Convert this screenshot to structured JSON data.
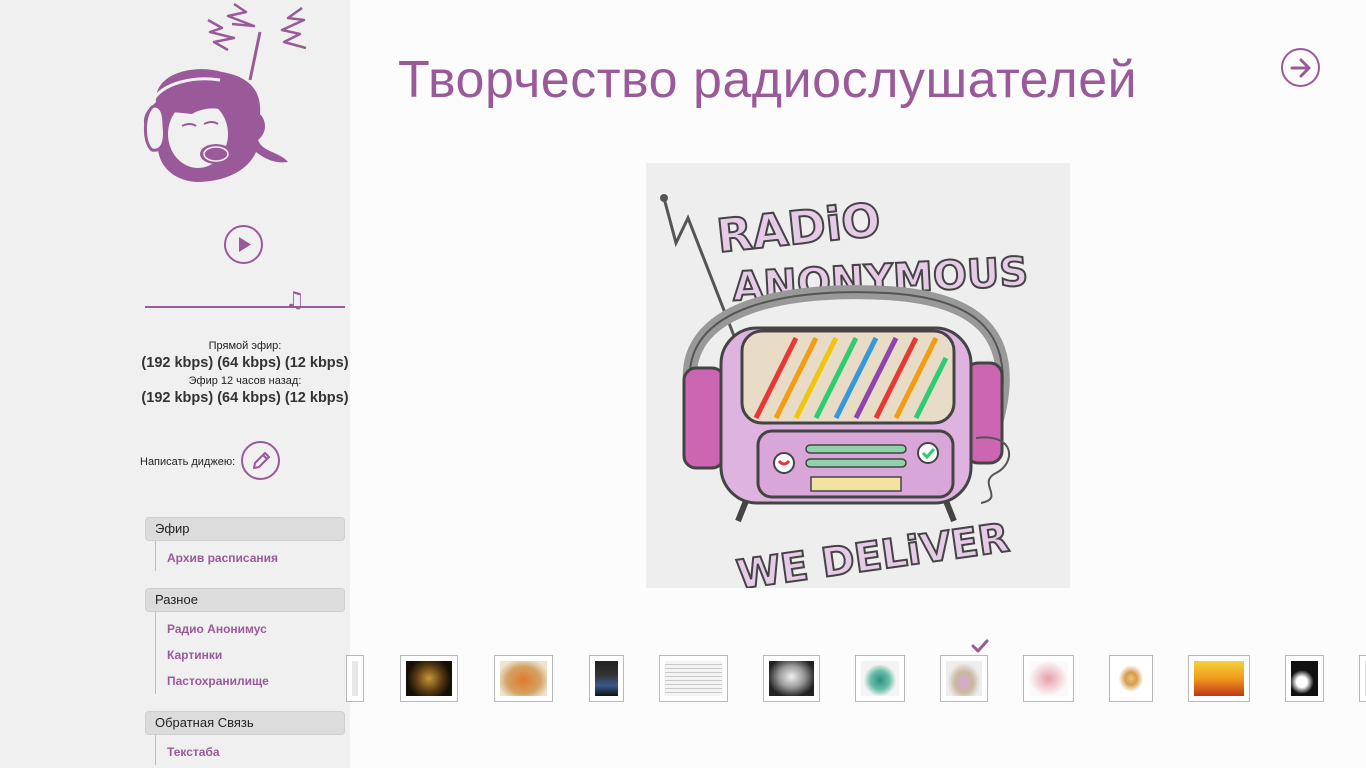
{
  "sidebar": {
    "live_label": "Прямой эфир:",
    "live_streams": [
      "(192 kbps)",
      "(64 kbps)",
      "(12 kbps)"
    ],
    "delayed_label": "Эфир 12 часов назад:",
    "delayed_streams": [
      "(192 kbps)",
      "(64 kbps)",
      "(12 kbps)"
    ],
    "dj_label": "Написать диджею:",
    "groups": [
      {
        "header": "Эфир",
        "items": [
          "Архив расписания"
        ]
      },
      {
        "header": "Разное",
        "items": [
          "Радио Анонимус",
          "Картинки",
          "Пастохранилище"
        ]
      },
      {
        "header": "Обратная Связь",
        "items": [
          "Текстаба"
        ]
      }
    ]
  },
  "main": {
    "title": "Творчество радиослушателей",
    "image_text": {
      "line1": "RADiO",
      "line2": "ANONYMOUS",
      "line3": "WE DELiVER"
    },
    "selected_thumbnail": 7
  },
  "colors": {
    "accent": "#9a5a9a",
    "sidebar_bg": "#f0f0f0",
    "main_bg": "#fdfcfd"
  },
  "icons": {
    "play": "play-icon",
    "volume": "music-note-icon",
    "dj": "pencil-icon",
    "next": "arrow-right-icon",
    "selected": "checkmark-icon"
  }
}
